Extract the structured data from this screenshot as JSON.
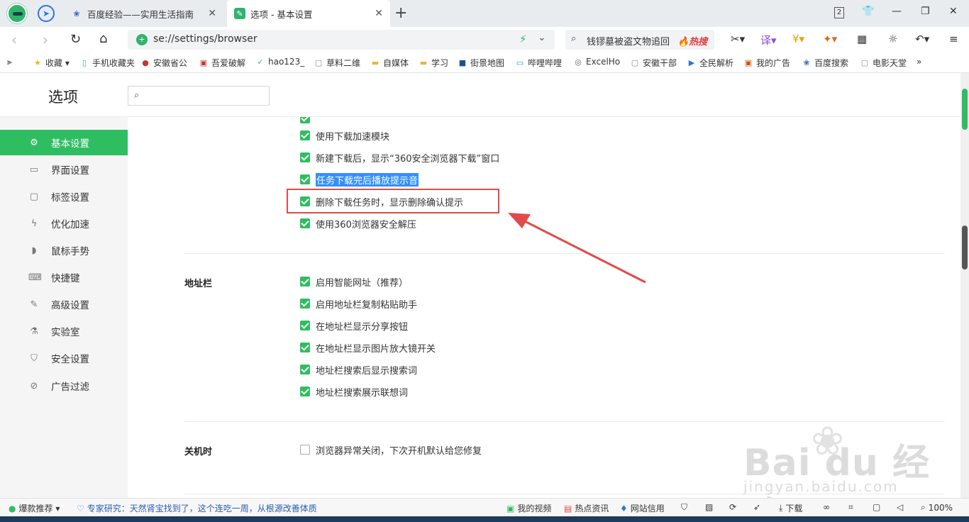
{
  "tabs": {
    "tab1_title": "百度经验——实用生活指南",
    "tab2_title": "选项 - 基本设置",
    "new_tab_symbol": "+"
  },
  "window": {
    "tab_count_badge": "2"
  },
  "address": {
    "url": "se://settings/browser",
    "search_text": "钱镠墓被盗文物追回",
    "hot_label": "🔥热搜"
  },
  "bookmarks": [
    {
      "label": "收藏",
      "icon": "star-icon"
    },
    {
      "label": "手机收藏夹",
      "icon": "phone-icon"
    },
    {
      "label": "安徽省公",
      "icon": "emblem-icon"
    },
    {
      "label": "吾爱破解",
      "icon": "site-icon"
    },
    {
      "label": "hao123_",
      "icon": "hao-icon"
    },
    {
      "label": "草料二维",
      "icon": "page-icon"
    },
    {
      "label": "自媒体",
      "icon": "folder-icon"
    },
    {
      "label": "学习",
      "icon": "folder-icon"
    },
    {
      "label": "街景地图",
      "icon": "map-icon"
    },
    {
      "label": "哔哩哔哩",
      "icon": "bilibili-icon"
    },
    {
      "label": "ExcelHo",
      "icon": "globe-icon"
    },
    {
      "label": "安徽干部",
      "icon": "page-icon"
    },
    {
      "label": "全民解析",
      "icon": "play-icon"
    },
    {
      "label": "我的广告",
      "icon": "site-icon"
    },
    {
      "label": "百度搜索",
      "icon": "paw-icon"
    },
    {
      "label": "电影天堂",
      "icon": "page-icon"
    }
  ],
  "page": {
    "title": "选项",
    "search_placeholder": ""
  },
  "sidebar": {
    "items": [
      {
        "label": "基本设置",
        "icon": "gear-icon",
        "active": true
      },
      {
        "label": "界面设置",
        "icon": "window-icon"
      },
      {
        "label": "标签设置",
        "icon": "tab-icon"
      },
      {
        "label": "优化加速",
        "icon": "bolt-icon"
      },
      {
        "label": "鼠标手势",
        "icon": "mouse-icon"
      },
      {
        "label": "快捷键",
        "icon": "keyboard-icon"
      },
      {
        "label": "高级设置",
        "icon": "wrench-icon"
      },
      {
        "label": "实验室",
        "icon": "flask-icon"
      },
      {
        "label": "安全设置",
        "icon": "shield-icon"
      },
      {
        "label": "广告过滤",
        "icon": "block-icon"
      }
    ]
  },
  "download": {
    "options": [
      {
        "label": "使用下载加速模块",
        "checked": true
      },
      {
        "label": "新建下载后，显示“360安全浏览器下载”窗口",
        "checked": true
      },
      {
        "label": "任务下载完后播放提示音",
        "checked": true,
        "selected": true
      },
      {
        "label": "删除下载任务时，显示删除确认提示",
        "checked": true
      },
      {
        "label": "使用360浏览器安全解压",
        "checked": true
      }
    ]
  },
  "addressbar": {
    "label": "地址栏",
    "options": [
      {
        "label": "启用智能网址（推荐）",
        "checked": true
      },
      {
        "label": "启用地址栏复制粘贴助手",
        "checked": true
      },
      {
        "label": "在地址栏显示分享按钮",
        "checked": true
      },
      {
        "label": "在地址栏显示图片放大镜开关",
        "checked": true
      },
      {
        "label": "地址栏搜索后显示搜索词",
        "checked": true
      },
      {
        "label": "地址栏搜索展示联想词",
        "checked": true
      }
    ]
  },
  "shutdown": {
    "label": "关机时",
    "options": [
      {
        "label": "浏览器异常关闭，下次开机默认给您修复",
        "checked": false
      }
    ]
  },
  "watermark": {
    "brand": "Bai du 经验",
    "site": "jingyan.baidu.com"
  },
  "status": {
    "promo": "爆款推荐",
    "news": "专家研究：天然肾宝找到了，这个连吃一周，从根源改善体质",
    "my_video": "我的视频",
    "hot_news": "热点资讯",
    "site_credit": "网站信用",
    "download": "下载",
    "zoom": "100%"
  },
  "colors": {
    "accent": "#2fbd62",
    "highlight": "#3390ff",
    "annotation": "#e24a4a"
  }
}
